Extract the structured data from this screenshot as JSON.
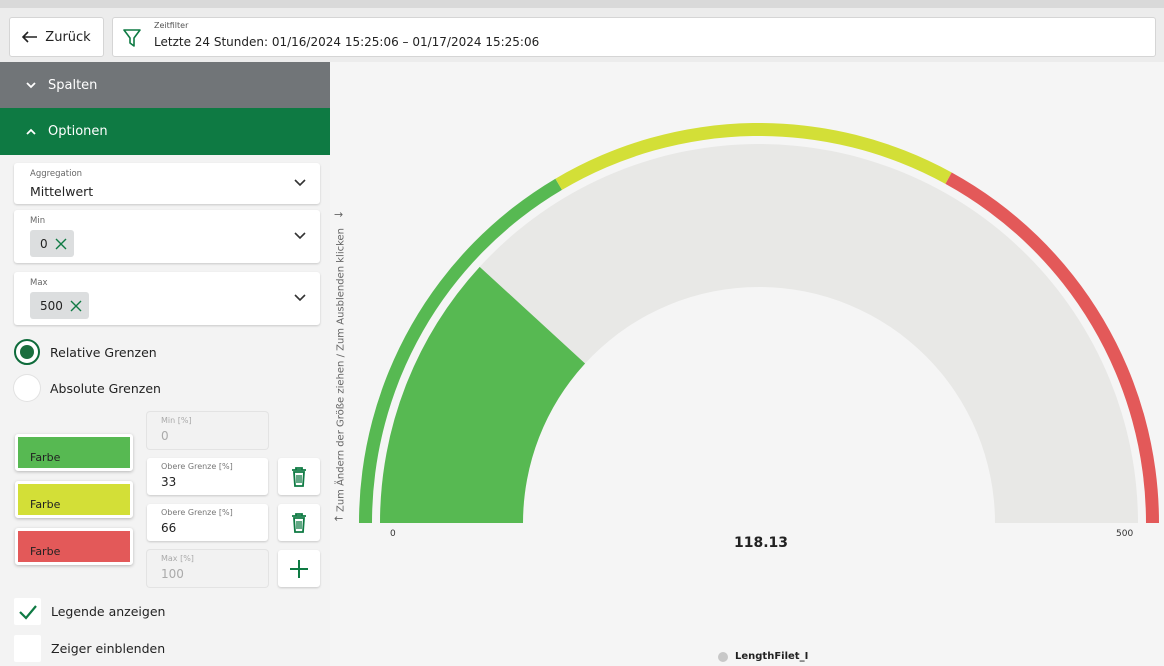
{
  "header": {
    "back_label": "Zurück",
    "filter_label": "Zeitfilter",
    "filter_value": "Letzte 24 Stunden: 01/16/2024 15:25:06 – 01/17/2024 15:25:06"
  },
  "sidebar": {
    "sections": [
      {
        "label": "Spalten",
        "expanded": false
      },
      {
        "label": "Optionen",
        "expanded": true
      }
    ],
    "aggregation": {
      "label": "Aggregation",
      "value": "Mittelwert"
    },
    "min": {
      "label": "Min",
      "value": "0"
    },
    "max": {
      "label": "Max",
      "value": "500"
    },
    "bounds_mode": {
      "options": [
        "Relative Grenzen",
        "Absolute Grenzen"
      ],
      "selected": "Relative Grenzen"
    },
    "ranges": {
      "min": {
        "label": "Min [%]",
        "value": "0"
      },
      "colors": [
        {
          "label": "Farbe",
          "color": "#57b952"
        },
        {
          "label": "Farbe",
          "color": "#d3df37"
        },
        {
          "label": "Farbe",
          "color": "#e35959"
        }
      ],
      "upper": [
        {
          "label": "Obere Grenze [%]",
          "value": "33"
        },
        {
          "label": "Obere Grenze [%]",
          "value": "66"
        }
      ],
      "max": {
        "label": "Max [%]",
        "value": "100"
      }
    },
    "show_legend": {
      "label": "Legende anzeigen",
      "checked": true
    },
    "show_pointer": {
      "label": "Zeiger einblenden",
      "checked": false
    }
  },
  "resize_hint": "Zum Ändern der Größe ziehen / Zum Ausblenden klicken",
  "colors": {
    "accent": "#0e7a43",
    "header_gray": "#717578",
    "green": "#57b952",
    "yellow": "#d3df37",
    "red": "#e35959",
    "track": "#e8e8e6"
  },
  "chart_data": {
    "type": "gauge",
    "min": 0,
    "max": 500,
    "value": 118.13,
    "value_label": "118.13",
    "min_label": "0",
    "max_label": "500",
    "bands": [
      {
        "from_pct": 0,
        "to_pct": 33,
        "color": "#57b952"
      },
      {
        "from_pct": 33,
        "to_pct": 66,
        "color": "#d3df37"
      },
      {
        "from_pct": 66,
        "to_pct": 100,
        "color": "#e35959"
      }
    ],
    "series": [
      {
        "name": "LengthFilet_I"
      }
    ],
    "legend": "bottom-center"
  }
}
